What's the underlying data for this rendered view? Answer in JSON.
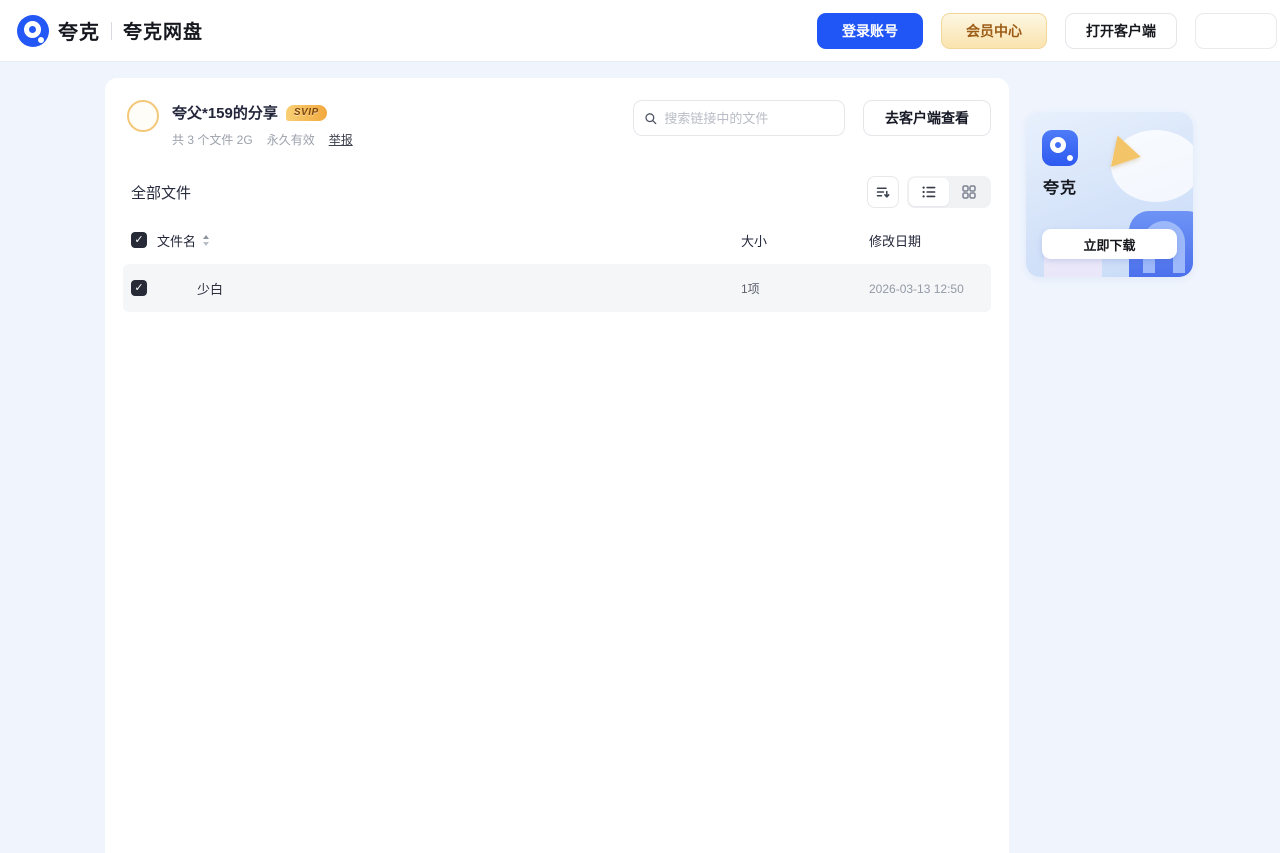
{
  "header": {
    "brand": "夸克",
    "brand_sub": "夸克网盘",
    "login_button": "登录账号",
    "vip_button": "会员中心",
    "open_client_button": "打开客户端"
  },
  "share": {
    "title": "夸父*159的分享",
    "badge": "SVIP",
    "meta": "共 3 个文件 2G",
    "validity": "永久有效",
    "report_link": "举报",
    "search_placeholder": "搜索链接中的文件",
    "view_in_client_button": "去客户端查看"
  },
  "files": {
    "section_title": "全部文件",
    "columns": {
      "name": "文件名",
      "size": "大小",
      "modified": "修改日期"
    },
    "rows": [
      {
        "name": "少白",
        "size": "1项",
        "modified": "2026-03-13 12:50",
        "checked": true
      }
    ],
    "select_all_checked": true
  },
  "promo": {
    "app_name": "夸克",
    "download_button": "立即下载"
  },
  "colors": {
    "accent_blue": "#2156f6",
    "vip_text": "#9c5c16",
    "vip_bg": "#fae3ae",
    "page_bg": "#eff4fd",
    "row_bg": "#f5f6f7",
    "badge_gold": "#f2a93e"
  }
}
